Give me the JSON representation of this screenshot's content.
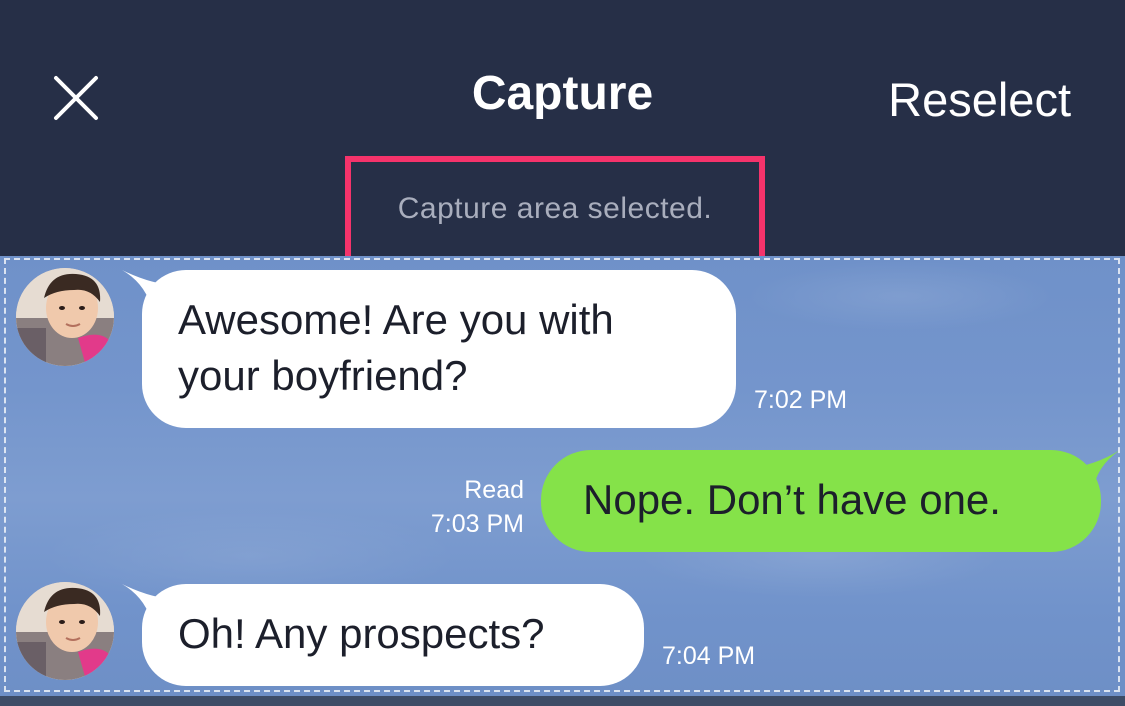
{
  "header": {
    "title": "Capture",
    "reselect_label": "Reselect",
    "close_icon": "close-icon"
  },
  "status": {
    "text": "Capture area selected."
  },
  "messages": [
    {
      "direction": "incoming",
      "text_lines": [
        "Awesome! Are you with",
        "your boyfriend?"
      ],
      "time": "7:02 PM"
    },
    {
      "direction": "outgoing",
      "text_lines": [
        "Nope. Don’t have one."
      ],
      "read_label": "Read",
      "time": "7:03 PM"
    },
    {
      "direction": "incoming",
      "text_lines": [
        "Oh! Any prospects?"
      ],
      "time": "7:04 PM"
    }
  ],
  "colors": {
    "header_bg": "#262f47",
    "highlight_border": "#f5336b",
    "outgoing_bubble": "#85e249",
    "incoming_bubble": "#ffffff",
    "chat_bg": "#7495cc"
  }
}
